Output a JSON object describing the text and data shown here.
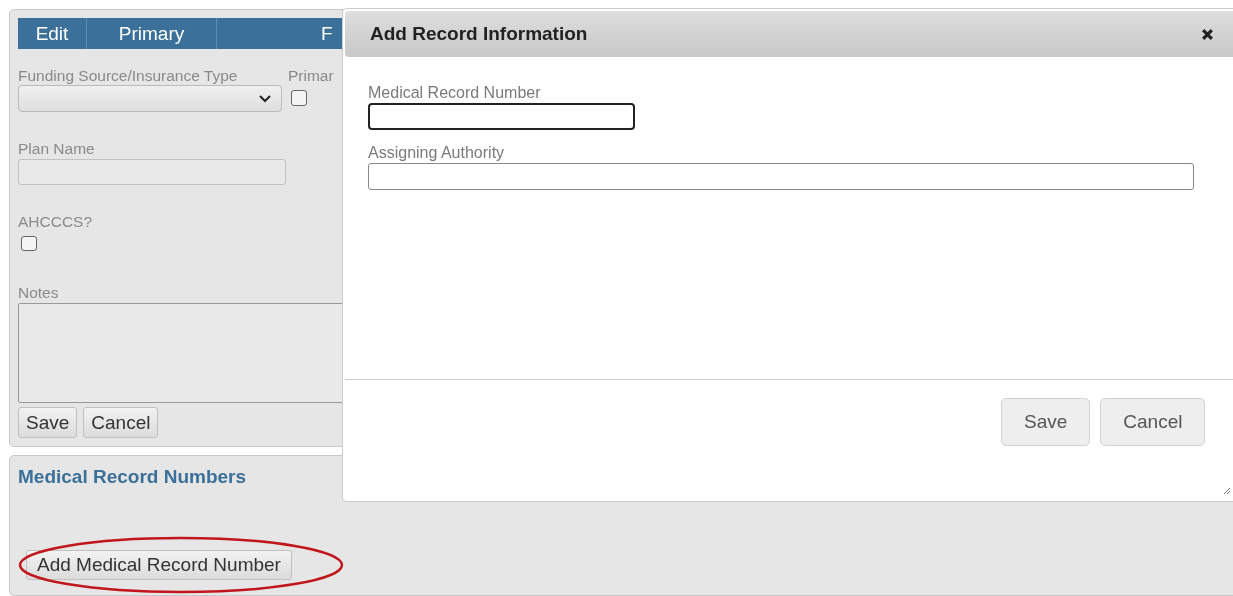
{
  "form": {
    "columns": [
      {
        "label": "Edit"
      },
      {
        "label": "Primary"
      },
      {
        "label": "F"
      }
    ],
    "funding_label": "Funding Source/Insurance Type",
    "primary_label": "Primar",
    "primary_checked": false,
    "plan_name_label": "Plan Name",
    "ahcccs_label": "AHCCCS?",
    "ahcccs_checked": false,
    "notes_label": "Notes",
    "buttons": [
      "Save",
      "Cancel"
    ]
  },
  "mrn_section": {
    "title": "Medical Record Numbers",
    "add_button": "Add Medical Record Number",
    "circled": true
  },
  "dialog": {
    "title": "Add Record Information",
    "fields": [
      {
        "label": "Medical Record Number",
        "focused": true
      },
      {
        "label": "Assigning Authority",
        "focused": false
      }
    ],
    "buttons": [
      "Save",
      "Cancel"
    ]
  }
}
